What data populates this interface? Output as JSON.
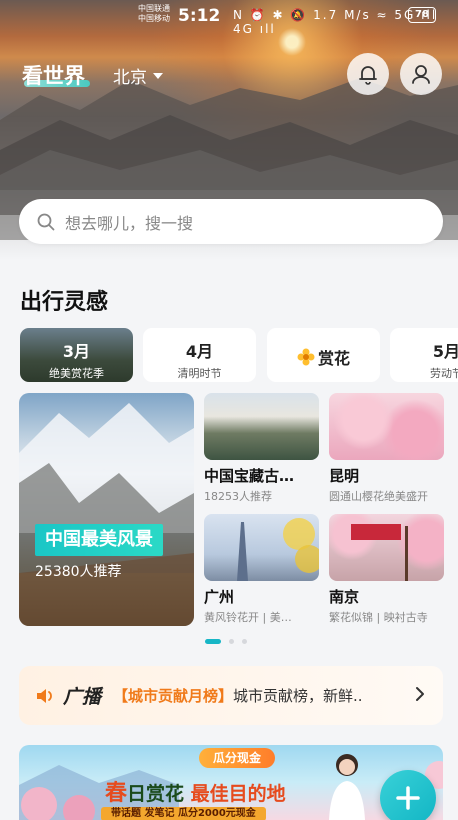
{
  "status_bar": {
    "carrier_1": "中国联通",
    "carrier_2": "中国移动",
    "time": "5:12",
    "icons_text": "N ⏰ ✱ 🔕 1.7 M/s ≈ 5G ıll 4G ıll",
    "battery": "78"
  },
  "header": {
    "title": "看世界",
    "city": "北京"
  },
  "search": {
    "placeholder": "想去哪儿，搜一搜"
  },
  "inspiration": {
    "title": "出行灵感",
    "chips": [
      {
        "big": "3月",
        "small": "绝美赏花季"
      },
      {
        "big": "4月",
        "small": "清明时节"
      },
      {
        "big": "赏花",
        "small": ""
      },
      {
        "big": "5月",
        "small": "劳动节"
      }
    ],
    "feature": {
      "tag": "中国最美风景",
      "count": "25380人推荐"
    },
    "cards": [
      {
        "name": "中国宝藏古…",
        "sub": "18253人推荐"
      },
      {
        "name": "昆明",
        "sub": "圆通山樱花绝美盛开"
      },
      {
        "name": "广州",
        "sub": "黄风铃花开 | 美…"
      },
      {
        "name": "南京",
        "sub": "繁花似锦 | 映衬古寺"
      }
    ]
  },
  "broadcast": {
    "label": "广播",
    "highlight": "【城市贡献月榜】",
    "text": "城市贡献榜，新鲜.."
  },
  "banner": {
    "pill": "瓜分现金",
    "headline_a": "春",
    "headline_b": "日赏花",
    "headline_c": "最佳目的地",
    "strip": "带话题 发笔记 瓜分2000元现金"
  },
  "colors": {
    "accent": "#17b6c6",
    "broadcast_highlight": "#f07a1a"
  }
}
